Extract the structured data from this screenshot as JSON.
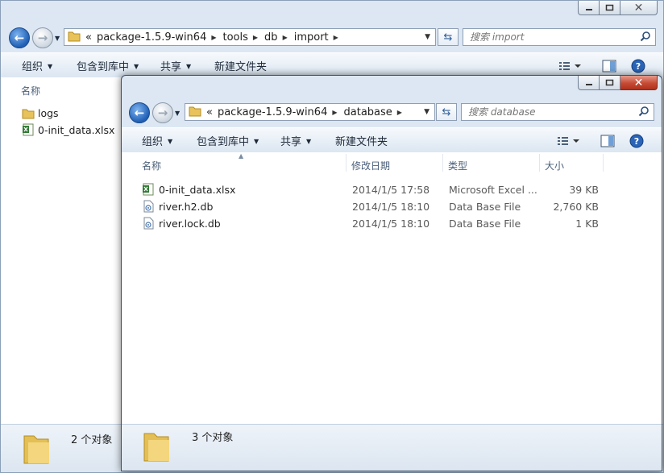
{
  "back_window": {
    "address": {
      "overflow": "«",
      "crumbs": [
        "package-1.5.9-win64",
        "tools",
        "db",
        "import"
      ]
    },
    "search_placeholder": "搜索 import",
    "toolbar": {
      "organize": "组织",
      "include_library": "包含到库中",
      "share": "共享",
      "new_folder": "新建文件夹"
    },
    "column_name": "名称",
    "files": [
      {
        "name": "logs",
        "icon": "folder-icon"
      },
      {
        "name": "0-init_data.xlsx",
        "icon": "excel-file-icon"
      }
    ],
    "status": "2 个对象"
  },
  "front_window": {
    "address": {
      "overflow": "«",
      "crumbs": [
        "package-1.5.9-win64",
        "database"
      ]
    },
    "search_placeholder": "搜索 database",
    "toolbar": {
      "organize": "组织",
      "include_library": "包含到库中",
      "share": "共享",
      "new_folder": "新建文件夹"
    },
    "columns": {
      "name": "名称",
      "modified": "修改日期",
      "type": "类型",
      "size": "大小"
    },
    "files": [
      {
        "name": "0-init_data.xlsx",
        "modified": "2014/1/5 17:58",
        "type": "Microsoft Excel ...",
        "size": "39 KB",
        "icon": "excel-file-icon"
      },
      {
        "name": "river.h2.db",
        "modified": "2014/1/5 18:10",
        "type": "Data Base File",
        "size": "2,760 KB",
        "icon": "db-file-icon"
      },
      {
        "name": "river.lock.db",
        "modified": "2014/1/5 18:10",
        "type": "Data Base File",
        "size": "1 KB",
        "icon": "db-file-icon"
      }
    ],
    "status": "3 个对象"
  },
  "colors": {
    "frame": "#dce7f3",
    "toolbar": "#e6eef7",
    "close_red": "#c64a34",
    "nav_blue": "#1f5fb5"
  }
}
